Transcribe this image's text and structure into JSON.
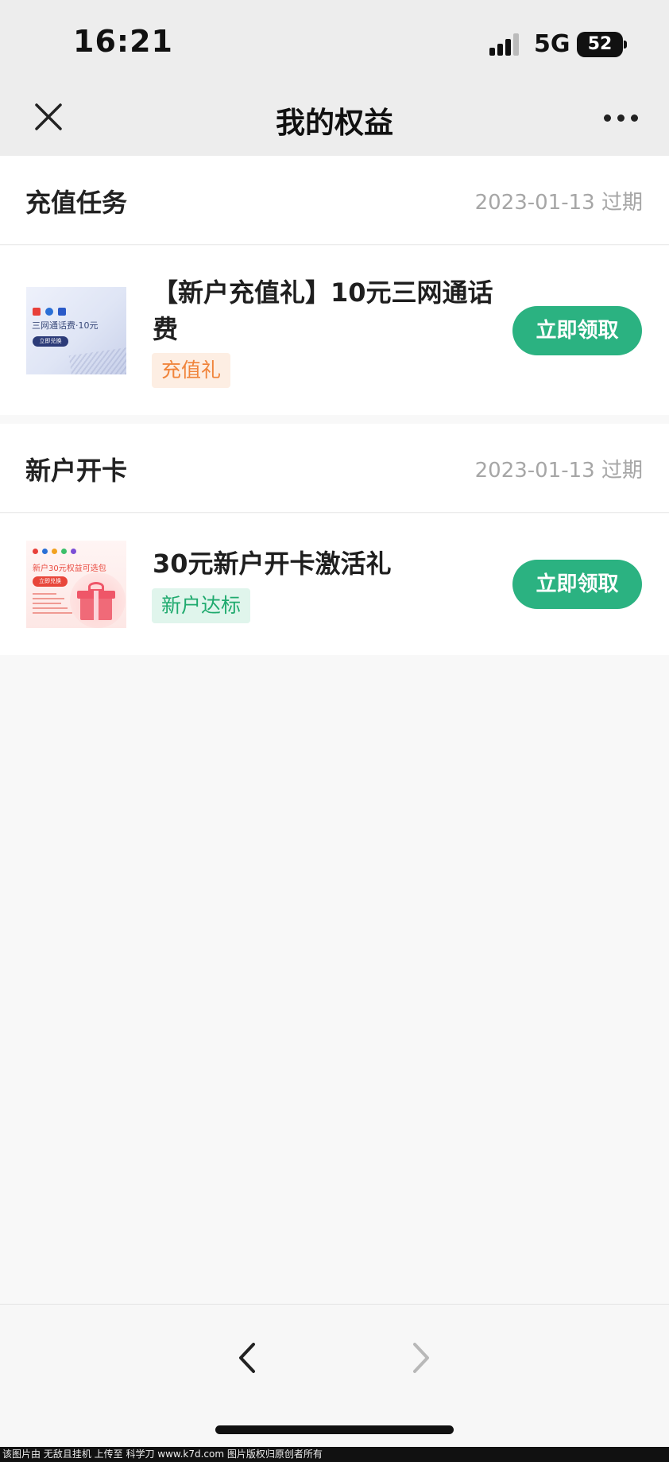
{
  "status_bar": {
    "time": "16:21",
    "network": "5G",
    "battery": "52"
  },
  "nav": {
    "title": "我的权益"
  },
  "sections": [
    {
      "title": "充值任务",
      "expiry": "2023-01-13 过期",
      "item": {
        "title_line1": "【新户充值礼】10元三网通话",
        "title_line2": "费",
        "tag": "充值礼",
        "button": "立即领取",
        "thumb_caption": "三网通话费·10元",
        "thumb_button": "立即兑换"
      }
    },
    {
      "title": "新户开卡",
      "expiry": "2023-01-13 过期",
      "item": {
        "title_line1": "30元新户开卡激活礼",
        "tag": "新户达标",
        "button": "立即领取",
        "thumb_caption": "新户30元权益可选包",
        "thumb_button": "立即兑换"
      }
    }
  ],
  "colors": {
    "accent": "#2bb281",
    "tag_orange": "#f0843b",
    "tag_green": "#1faa6e"
  },
  "icons": {
    "close": "close-icon",
    "more": "more-dots-icon",
    "back": "chevron-left-icon",
    "forward": "chevron-right-icon"
  },
  "watermark": "该图片由 无敌且挂机 上传至 科学刀 www.k7d.com 图片版权归原创者所有"
}
